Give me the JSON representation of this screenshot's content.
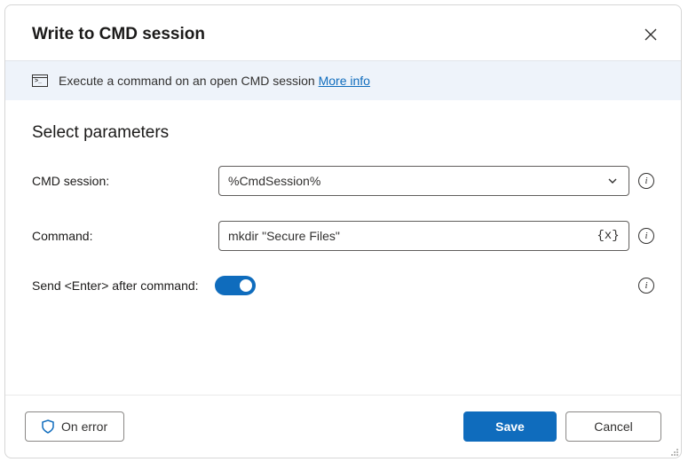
{
  "dialog": {
    "title": "Write to CMD session",
    "info_text": "Execute a command on an open CMD session",
    "more_info": "More info",
    "section_title": "Select parameters",
    "fields": {
      "cmd_session": {
        "label": "CMD session:",
        "value": "%CmdSession%"
      },
      "command": {
        "label": "Command:",
        "value": "mkdir \"Secure Files\""
      },
      "send_enter": {
        "label": "Send <Enter> after command:",
        "value": true
      }
    },
    "buttons": {
      "on_error": "On error",
      "save": "Save",
      "cancel": "Cancel"
    }
  }
}
